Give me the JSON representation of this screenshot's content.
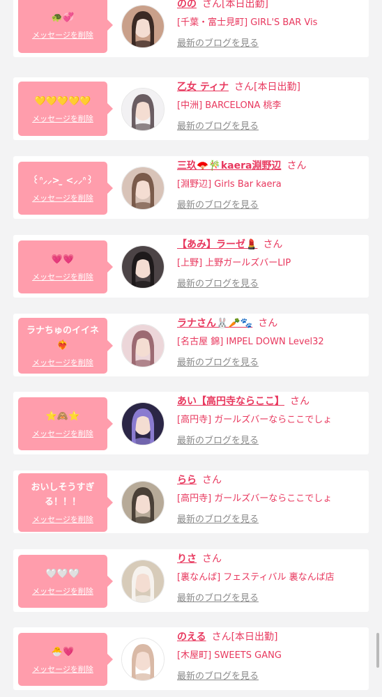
{
  "delete_label": "メッセージを削除",
  "blog_label": "最新のブログを見る",
  "colors": {
    "accent": "#e8385e",
    "bubble": "#ff9dac",
    "muted": "#8a8a8a",
    "background": "#f3f3f4"
  },
  "entries": [
    {
      "message": "🐢💞",
      "name": "のの",
      "suffix": "さん[本日出勤]",
      "shop": "[千葉・富士見町] GIRL'S BAR Vis",
      "avatar_colors": [
        "#c9a08a",
        "#3b2a24"
      ]
    },
    {
      "message": "💛💛💛💛💛",
      "name": "乙女 ティナ",
      "suffix": "さん[本日出勤]",
      "shop": "[中洲] BARCELONA 桃李",
      "avatar_colors": [
        "#f2f1f3",
        "#6a5d62"
      ]
    },
    {
      "message": "꒰ᐢ⸝⸝>  ̫ <⸝⸝ᐢ꒱",
      "name": "三玖🪭🎋kaera淵野辺",
      "suffix": "さん",
      "shop": "[淵野辺] Girls Bar kaera",
      "avatar_colors": [
        "#d8c3b8",
        "#7a5b4b"
      ]
    },
    {
      "message": "💗💗",
      "name": "【あみ】ラーゼ💄",
      "suffix": "さん",
      "shop": "[上野] 上野ガールズバーLIP",
      "avatar_colors": [
        "#4c4446",
        "#1e1a1b"
      ]
    },
    {
      "message": "ラナちゅのイイネ❤️‍🔥",
      "name": "ラナさん🐰🥕🐾",
      "suffix": "さん",
      "shop": "[名古屋 錦] IMPEL DOWN Level32",
      "avatar_colors": [
        "#ecd6d9",
        "#9c6a72"
      ]
    },
    {
      "message": "⭐️🙈⭐️",
      "name": "あい【高円寺ならここ】",
      "suffix": "さん",
      "shop": "[高円寺] ガールズバーならここでしょ",
      "avatar_colors": [
        "#2b2646",
        "#8a7bd0"
      ]
    },
    {
      "message": "おいしそうすぎる！！！",
      "name": "らら",
      "suffix": "さん",
      "shop": "[高円寺] ガールズバーならここでしょ",
      "avatar_colors": [
        "#b7aa98",
        "#4a4037"
      ]
    },
    {
      "message": "🤍🤍🤍",
      "name": "りさ",
      "suffix": "さん",
      "shop": "[裏なんば] フェスティバル 裏なんば店",
      "avatar_colors": [
        "#d7cbb9",
        "#f6f2ee"
      ]
    },
    {
      "message": "🐣💗",
      "name": "のえる",
      "suffix": "さん[本日出勤]",
      "shop": "[木屋町] SWEETS GANG",
      "avatar_colors": [
        "#ffffff",
        "#d9b9a6"
      ]
    }
  ]
}
